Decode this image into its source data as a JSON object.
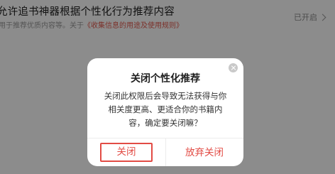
{
  "setting": {
    "title": "允许追书神器根据个性化行为推荐内容",
    "desc_prefix": "用于推荐优质内容等。关于",
    "desc_link": "《收集信息的用途及使用规则》",
    "status": "已开启"
  },
  "dialog": {
    "title": "关闭个性化推荐",
    "message": "关闭此权限后会导致无法获得与你相关度更高、更适合你的书籍内容，确定要关闭嘛？",
    "confirm_label": "关闭",
    "cancel_label": "放弃关闭"
  },
  "colors": {
    "accent": "#e24b44",
    "link": "#e15a4e",
    "overlay": "rgba(0,0,0,0.45)"
  },
  "icons": {
    "dialog_close": "close-icon",
    "status_arrow": "chevron-right-icon"
  }
}
